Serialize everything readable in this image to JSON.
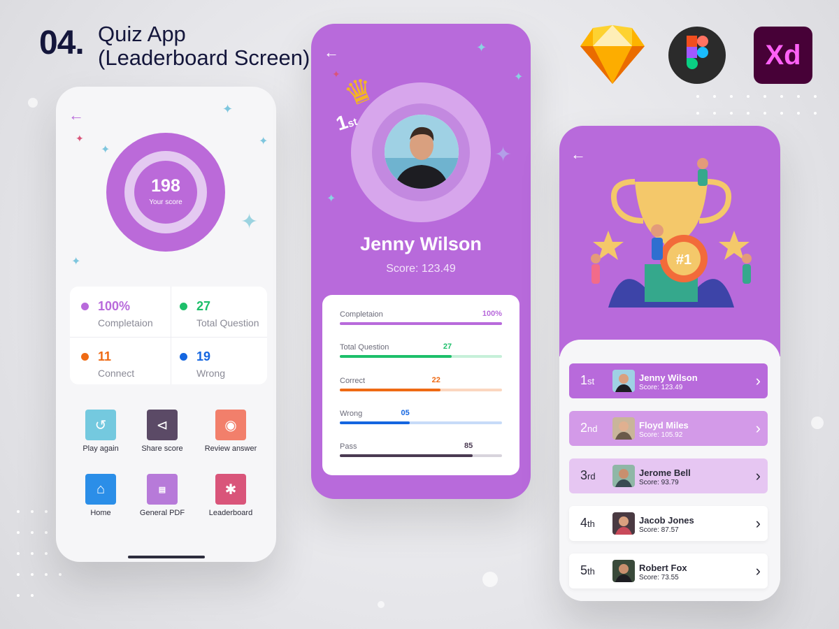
{
  "header": {
    "number": "04.",
    "title_line1": "Quiz App",
    "title_line2": "(Leaderboard  Screen)",
    "tools": [
      {
        "name": "sketch-icon"
      },
      {
        "name": "figma-icon"
      },
      {
        "name": "xd-icon",
        "label": "Xd"
      }
    ]
  },
  "colors": {
    "primary": "#b86adb",
    "green": "#1dbf6a",
    "orange": "#ef6a14",
    "blue": "#1566e0",
    "dark": "#14163b"
  },
  "result_screen": {
    "score_value": "198",
    "score_label": "Your score",
    "stats": [
      {
        "value": "100%",
        "label": "Completaion",
        "color": "#b86adb"
      },
      {
        "value": "27",
        "label": "Total Question",
        "color": "#1dbf6a"
      },
      {
        "value": "11",
        "label": "Connect",
        "color": "#ef6a14"
      },
      {
        "value": "19",
        "label": "Wrong",
        "color": "#1566e0"
      }
    ],
    "actions": [
      {
        "label": "Play again",
        "icon": "replay-icon",
        "color": "#74c9df"
      },
      {
        "label": "Share score",
        "icon": "share-icon",
        "color": "#5b4a66"
      },
      {
        "label": "Review answer",
        "icon": "eye-icon",
        "color": "#f27f6b"
      },
      {
        "label": "Home",
        "icon": "home-icon",
        "color": "#2b8ee8"
      },
      {
        "label": "General PDF",
        "icon": "pdf-icon",
        "color": "#b77ad9"
      },
      {
        "label": "Leaderboard",
        "icon": "stars-icon",
        "color": "#d9557a"
      }
    ]
  },
  "profile_screen": {
    "rank_badge": "1",
    "rank_suffix": "st",
    "name": "Jenny Wilson",
    "score": "Score: 123.49",
    "progress": [
      {
        "label": "Completaion",
        "value": "100%",
        "fraction": 1.0,
        "color": "#b86adb",
        "track": "#efdcf7"
      },
      {
        "label": "Total Question",
        "value": "27",
        "fraction": 0.69,
        "color": "#1dbf6a",
        "track": "#c6f0d9"
      },
      {
        "label": "Correct",
        "value": "22",
        "fraction": 0.62,
        "color": "#ef6a14",
        "track": "#fbd6bf"
      },
      {
        "label": "Wrong",
        "value": "05",
        "fraction": 0.43,
        "color": "#1566e0",
        "track": "#c7dbf8"
      },
      {
        "label": "Pass",
        "value": "85",
        "fraction": 0.82,
        "color": "#4a3a52",
        "track": "#d8d4dc"
      }
    ]
  },
  "leaderboard_screen": {
    "rows": [
      {
        "rank": "1",
        "suffix": "st",
        "name": "Jenny Wilson",
        "score": "Score: 123.49",
        "bg": "#b86adb",
        "text": "#ffffff"
      },
      {
        "rank": "2",
        "suffix": "nd",
        "name": "Floyd Miles",
        "score": "Score: 105.92",
        "bg": "#d39ae8",
        "text": "#ffffff"
      },
      {
        "rank": "3",
        "suffix": "rd",
        "name": "Jerome Bell",
        "score": "Score: 93.79",
        "bg": "#e6c6f2",
        "text": "#2a2a38"
      },
      {
        "rank": "4",
        "suffix": "th",
        "name": "Jacob Jones",
        "score": "Score: 87.57",
        "bg": "#ffffff",
        "text": "#2a2a38"
      },
      {
        "rank": "5",
        "suffix": "th",
        "name": "Robert Fox",
        "score": "Score: 73.55",
        "bg": "#ffffff",
        "text": "#2a2a38"
      }
    ],
    "trophy_badge": "#1"
  }
}
